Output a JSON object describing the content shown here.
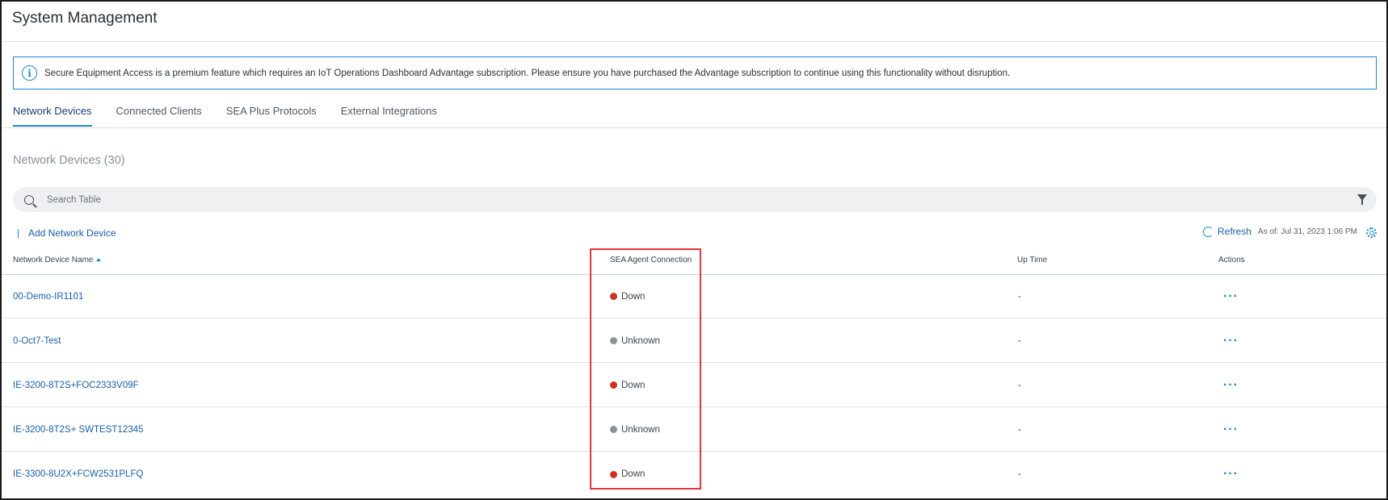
{
  "page": {
    "title": "System Management"
  },
  "banner": {
    "text": "Secure Equipment Access is a premium feature which requires an IoT Operations Dashboard Advantage subscription. Please ensure you have purchased the Advantage subscription to continue using this functionality without disruption."
  },
  "tabs": [
    {
      "label": "Network Devices",
      "active": true
    },
    {
      "label": "Connected Clients",
      "active": false
    },
    {
      "label": "SEA Plus Protocols",
      "active": false
    },
    {
      "label": "External Integrations",
      "active": false
    }
  ],
  "section": {
    "title": "Network Devices (30)"
  },
  "search": {
    "placeholder": "Search Table"
  },
  "toolbar": {
    "add_label": "Add Network Device",
    "refresh_label": "Refresh",
    "as_of": "As of: Jul 31, 2023 1:06 PM"
  },
  "table": {
    "columns": [
      "Network Device Name",
      "SEA Agent Connection",
      "Up Time",
      "Actions"
    ],
    "rows": [
      {
        "name": "00-Demo-IR1101",
        "status": "Down",
        "uptime": "-",
        "actions": "···"
      },
      {
        "name": "0-Oct7-Test",
        "status": "Unknown",
        "uptime": "-",
        "actions": "···"
      },
      {
        "name": "IE-3200-8T2S+FOC2333V09F",
        "status": "Down",
        "uptime": "-",
        "actions": "···"
      },
      {
        "name": "IE-3200-8T2S+ SWTEST12345",
        "status": "Unknown",
        "uptime": "-",
        "actions": "···"
      },
      {
        "name": "IE-3300-8U2X+FCW2531PLFQ",
        "status": "Down",
        "uptime": "-",
        "actions": "···"
      }
    ]
  },
  "colors": {
    "accent": "#1f86c8",
    "link": "#1a5fa8",
    "status_down": "#d0321f",
    "status_unknown": "#8a9299",
    "highlight": "#e0353b"
  }
}
